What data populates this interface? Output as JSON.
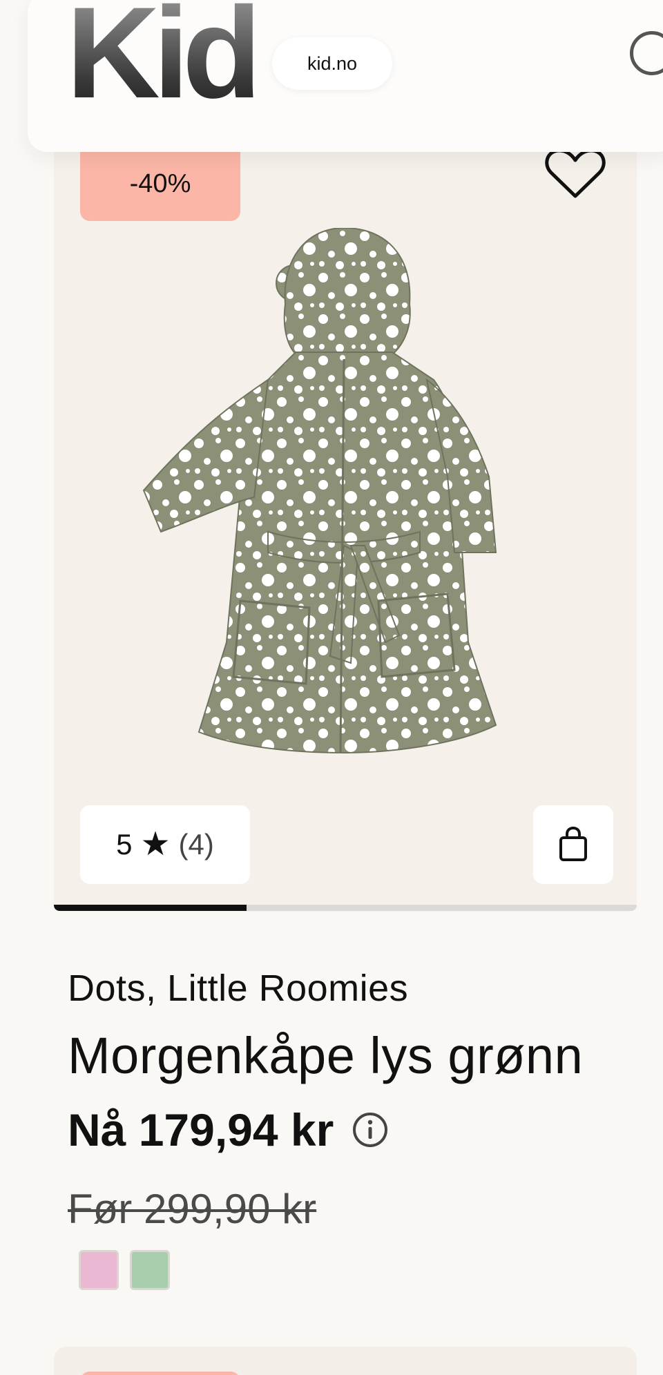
{
  "header": {
    "logo_text": "Kid",
    "domain_label": "kid.no"
  },
  "product": {
    "discount_badge": "-40%",
    "rating": {
      "score": "5",
      "star": "★",
      "count": "(4)"
    },
    "image_progress": 0.33,
    "brand": "Dots, Little Roomies",
    "name": "Morgenkåpe lys grønn",
    "price_now": "Nå 179,94 kr",
    "price_before": "Før 299,90 kr",
    "swatches": [
      {
        "color": "#ebb8d4"
      },
      {
        "color": "#a8cfad"
      }
    ]
  },
  "icons": {
    "wishlist": "heart-icon",
    "cart": "shopping-bag-icon",
    "info": "info-icon",
    "search": "search-icon"
  },
  "colors": {
    "background": "#faf8f4",
    "card": "#f5f1ea",
    "discount_badge": "#fbb6a7",
    "robe": "#8b9077",
    "dots": "#ffffff"
  }
}
